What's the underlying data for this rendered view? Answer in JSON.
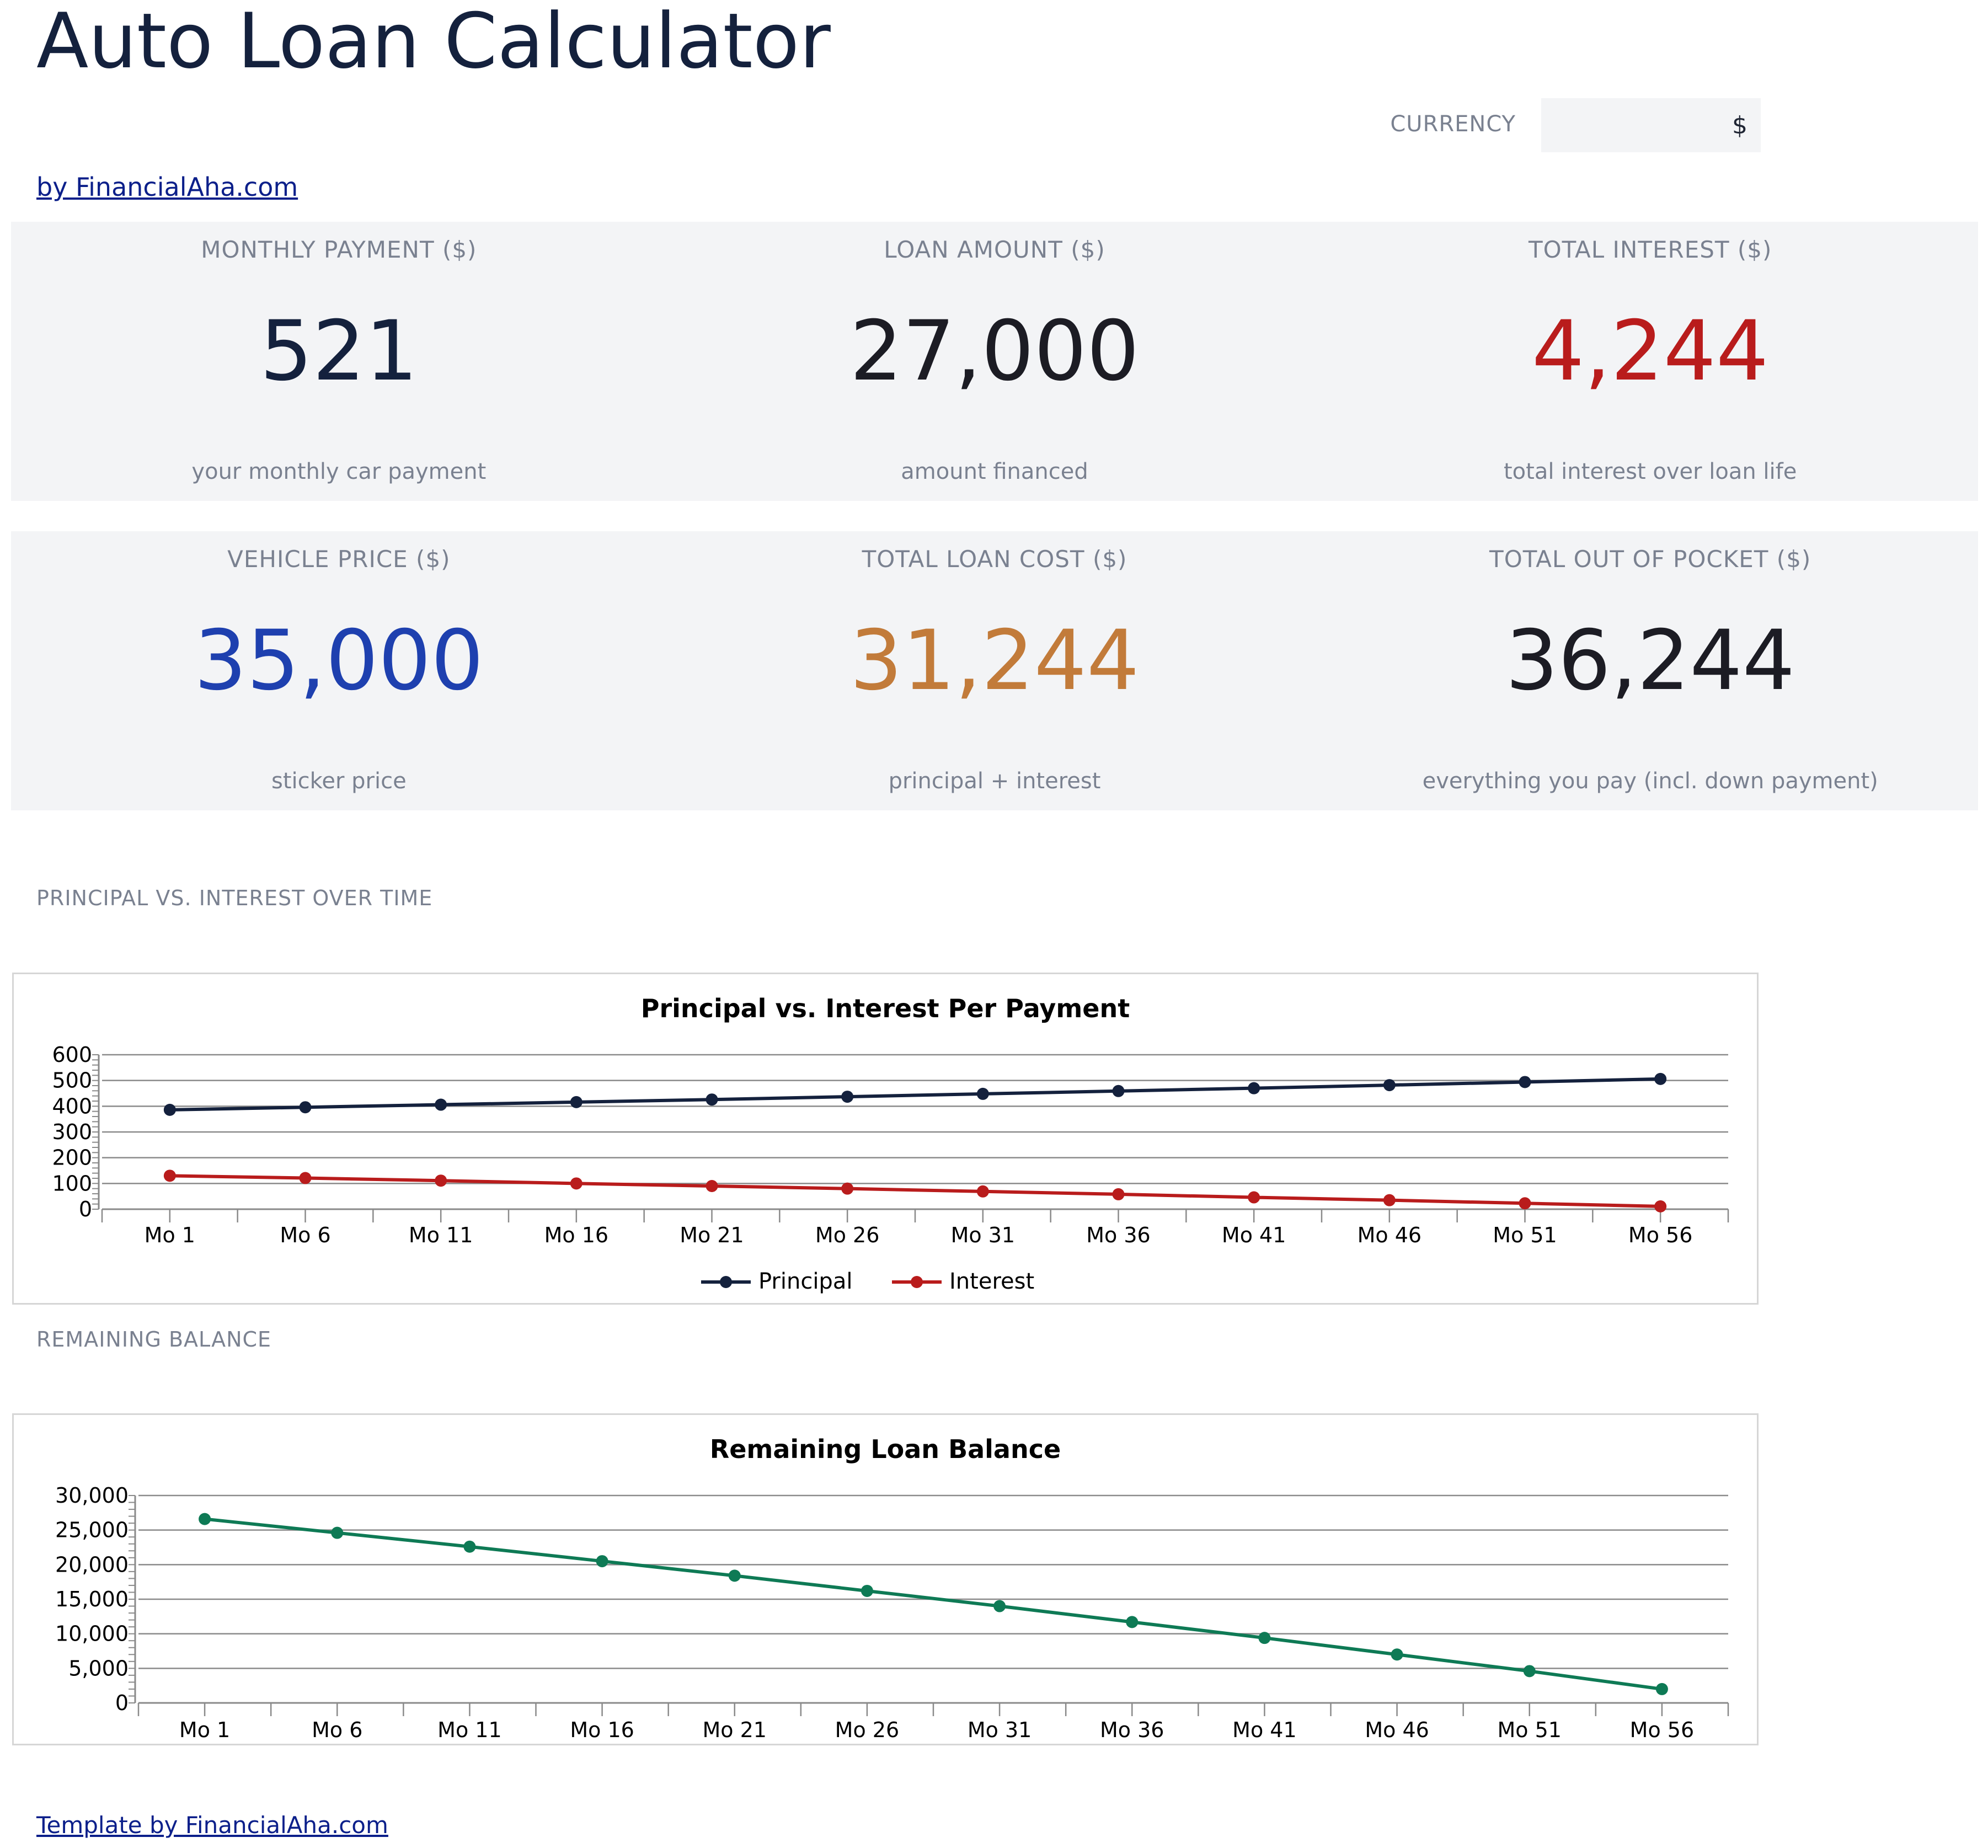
{
  "title": "Auto Loan Calculator",
  "currency": {
    "label": "CURRENCY",
    "value": "$"
  },
  "byline": "by FinancialAha.com",
  "footer_link": "Template by FinancialAha.com",
  "kpis": [
    {
      "label": "MONTHLY PAYMENT ($)",
      "value": "521",
      "sub": "your monthly car payment",
      "color": "#14213d"
    },
    {
      "label": "LOAN AMOUNT ($)",
      "value": "27,000",
      "sub": "amount financed",
      "color": "#1c1c24"
    },
    {
      "label": "TOTAL INTEREST ($)",
      "value": "4,244",
      "sub": "total interest over loan life",
      "color": "#b91c1c"
    },
    {
      "label": "VEHICLE PRICE ($)",
      "value": "35,000",
      "sub": "sticker price",
      "color": "#1e40af"
    },
    {
      "label": "TOTAL LOAN COST ($)",
      "value": "31,244",
      "sub": "principal + interest",
      "color": "#c27b3a"
    },
    {
      "label": "TOTAL OUT OF POCKET ($)",
      "value": "36,244",
      "sub": "everything you pay (incl. down payment)",
      "color": "#1c1c24"
    }
  ],
  "sections": {
    "chart1_label": "PRINCIPAL VS. INTEREST OVER TIME",
    "chart2_label": "REMAINING BALANCE"
  },
  "chart_data": [
    {
      "type": "line",
      "title": "Principal vs. Interest Per Payment",
      "xlabel": "",
      "ylabel": "",
      "categories": [
        "Mo 1",
        "Mo 6",
        "Mo 11",
        "Mo 16",
        "Mo 21",
        "Mo 26",
        "Mo 31",
        "Mo 36",
        "Mo 41",
        "Mo 46",
        "Mo 51",
        "Mo 56"
      ],
      "yticks": [
        "0",
        "100",
        "200",
        "300",
        "400",
        "500",
        "600"
      ],
      "ylim": [
        0,
        600
      ],
      "grid": true,
      "legend": "bottom-center",
      "series": [
        {
          "name": "Principal",
          "color": "#14213d",
          "values": [
            386,
            396,
            406,
            416,
            426,
            437,
            448,
            459,
            470,
            482,
            494,
            506
          ]
        },
        {
          "name": "Interest",
          "color": "#b91c1c",
          "values": [
            130,
            121,
            111,
            100,
            90,
            80,
            69,
            58,
            46,
            35,
            23,
            11
          ]
        }
      ]
    },
    {
      "type": "line",
      "title": "Remaining Loan Balance",
      "xlabel": "",
      "ylabel": "",
      "categories": [
        "Mo 1",
        "Mo 6",
        "Mo 11",
        "Mo 16",
        "Mo 21",
        "Mo 26",
        "Mo 31",
        "Mo 36",
        "Mo 41",
        "Mo 46",
        "Mo 51",
        "Mo 56"
      ],
      "yticks": [
        "0",
        "5,000",
        "10,000",
        "15,000",
        "20,000",
        "25,000",
        "30,000"
      ],
      "ylim": [
        0,
        30000
      ],
      "grid": true,
      "legend": "none",
      "series": [
        {
          "name": "",
          "color": "#0e7a55",
          "values": [
            26600,
            24600,
            22600,
            20500,
            18400,
            16200,
            14000,
            11700,
            9400,
            7000,
            4600,
            2000
          ]
        }
      ]
    }
  ]
}
